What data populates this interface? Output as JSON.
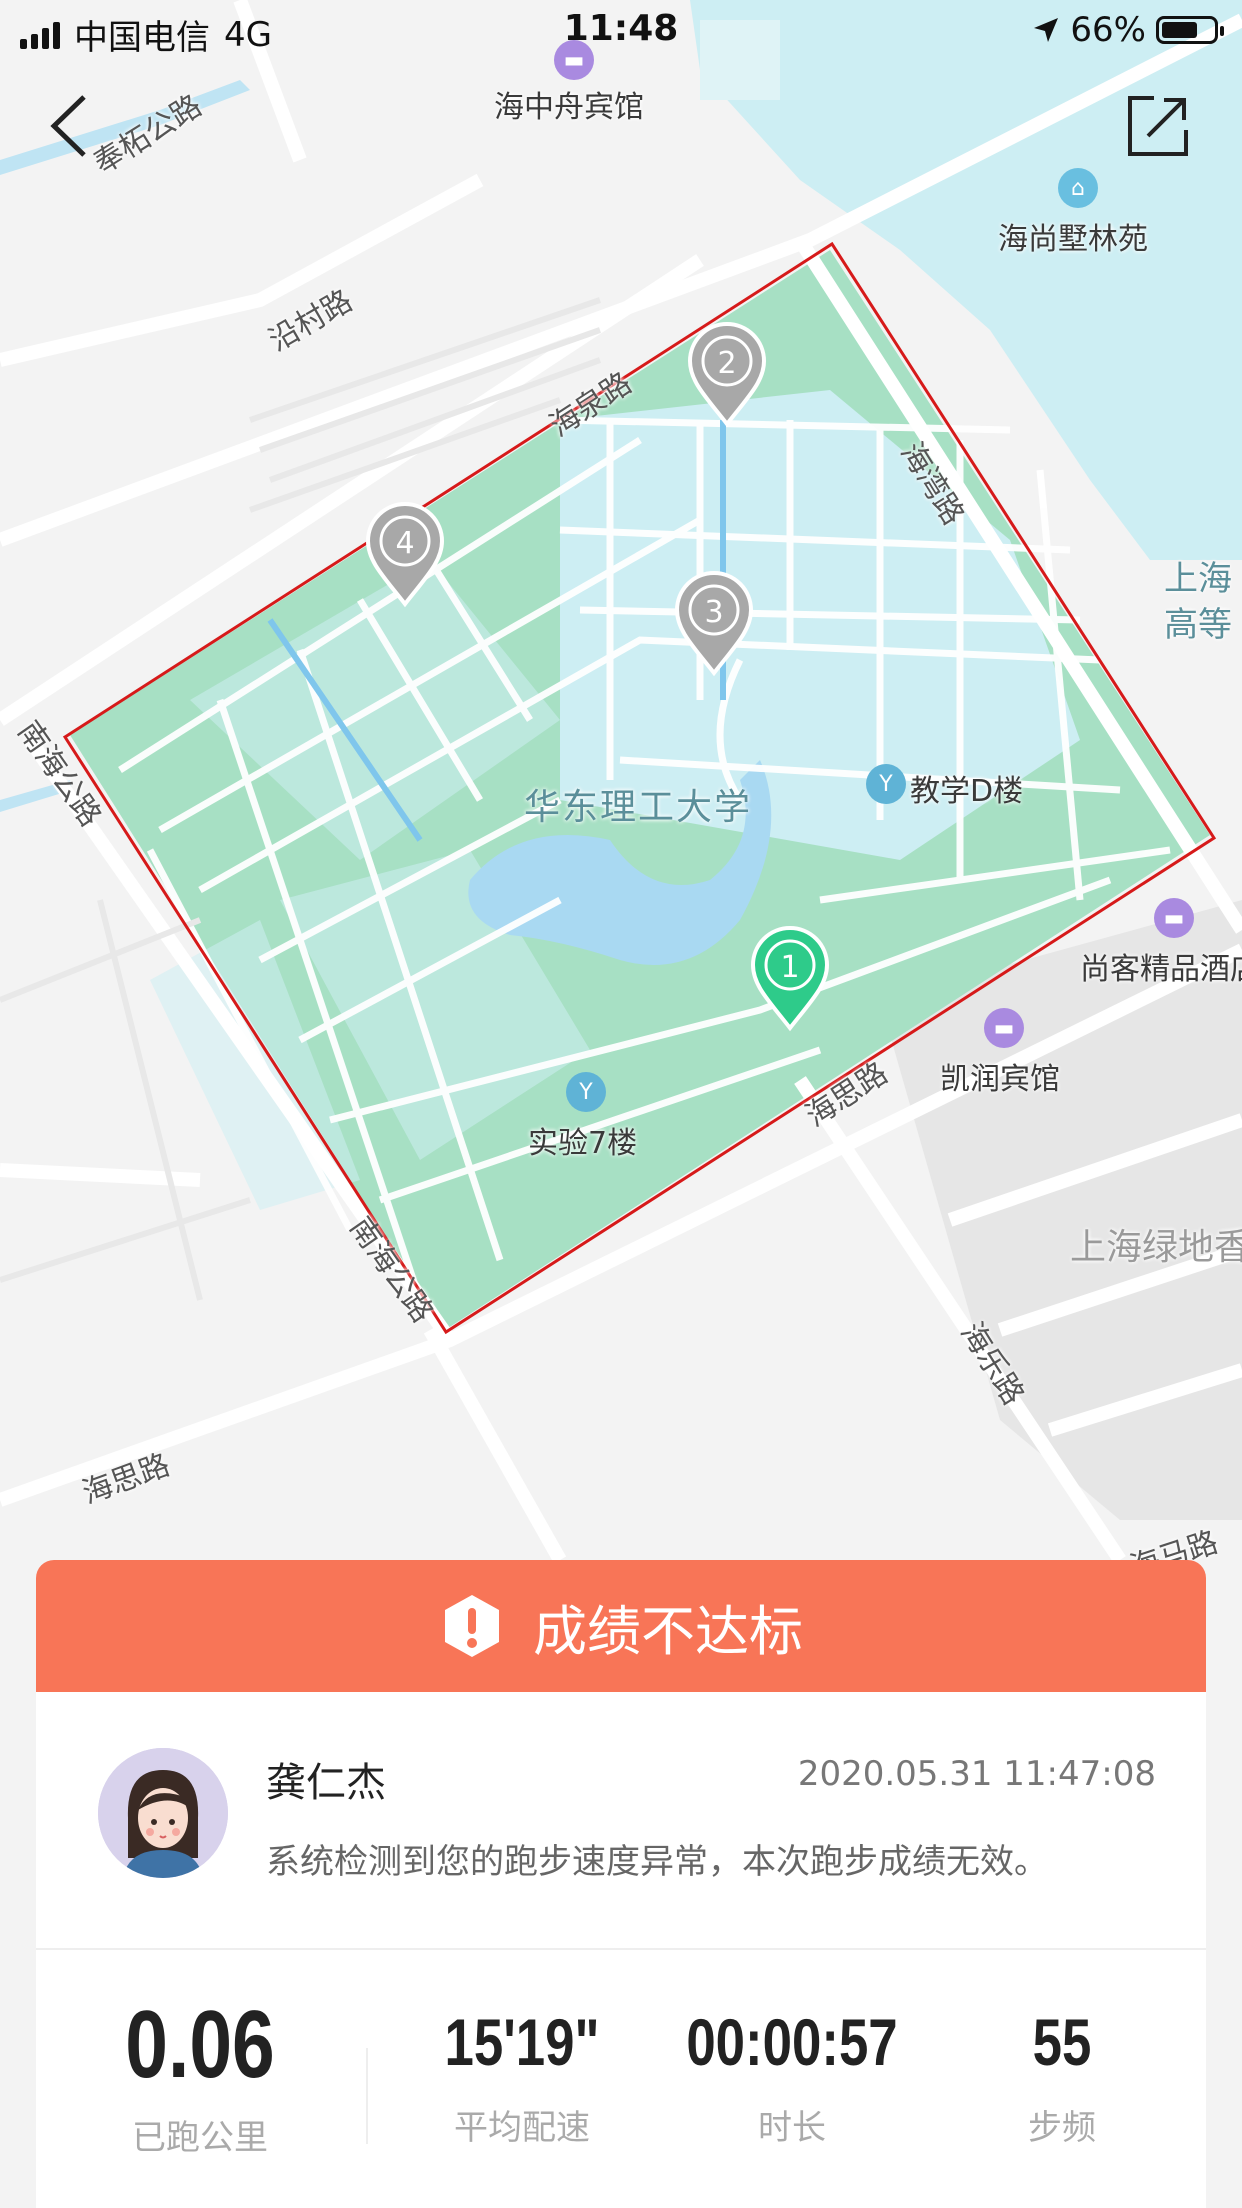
{
  "status_bar": {
    "carrier": "中国电信",
    "network": "4G",
    "time": "11:48",
    "battery": "66%"
  },
  "map": {
    "labels": {
      "hotel_haizhongzhou": "海中舟宾馆",
      "haishang": "海尚墅林苑",
      "shanghai_gaodeng": "上海\n高等",
      "campus": "华东理工大学",
      "teaching_d": "教学D楼",
      "shangke": "尚客精品酒店",
      "kairun": "凯润宾馆",
      "lab7": "实验7楼",
      "shanghai_lvdi": "上海绿地香"
    },
    "roads": {
      "fengzhe": "奉柘公路",
      "yancun": "沿村路",
      "haiquan": "海泉路",
      "haiwan": "海湾路",
      "nanhai_top": "南海公路",
      "nanhai_bottom": "南海公路",
      "haisi_center": "海思路",
      "haisi_left": "海思路",
      "haile": "海乐路",
      "haima": "海马路"
    },
    "markers": [
      "1",
      "2",
      "3",
      "4"
    ],
    "marker_colors": {
      "start": "#2ecb8a",
      "checkpoint": "#a8a8a8"
    },
    "colors": {
      "campus_green": "#a7e0c4",
      "route": "#d61a1a",
      "water": "#bfe4f3"
    }
  },
  "result": {
    "banner_text": "成绩不达标",
    "banner_color": "#f87557",
    "user_name": "龚仁杰",
    "timestamp": "2020.05.31 11:47:08",
    "message": "系统检测到您的跑步速度异常，本次跑步成绩无效。",
    "stats": [
      {
        "value": "0.06",
        "label": "已跑公里"
      },
      {
        "value": "15'19\"",
        "label": "平均配速"
      },
      {
        "value": "00:00:57",
        "label": "时长"
      },
      {
        "value": "55",
        "label": "步频"
      }
    ]
  }
}
